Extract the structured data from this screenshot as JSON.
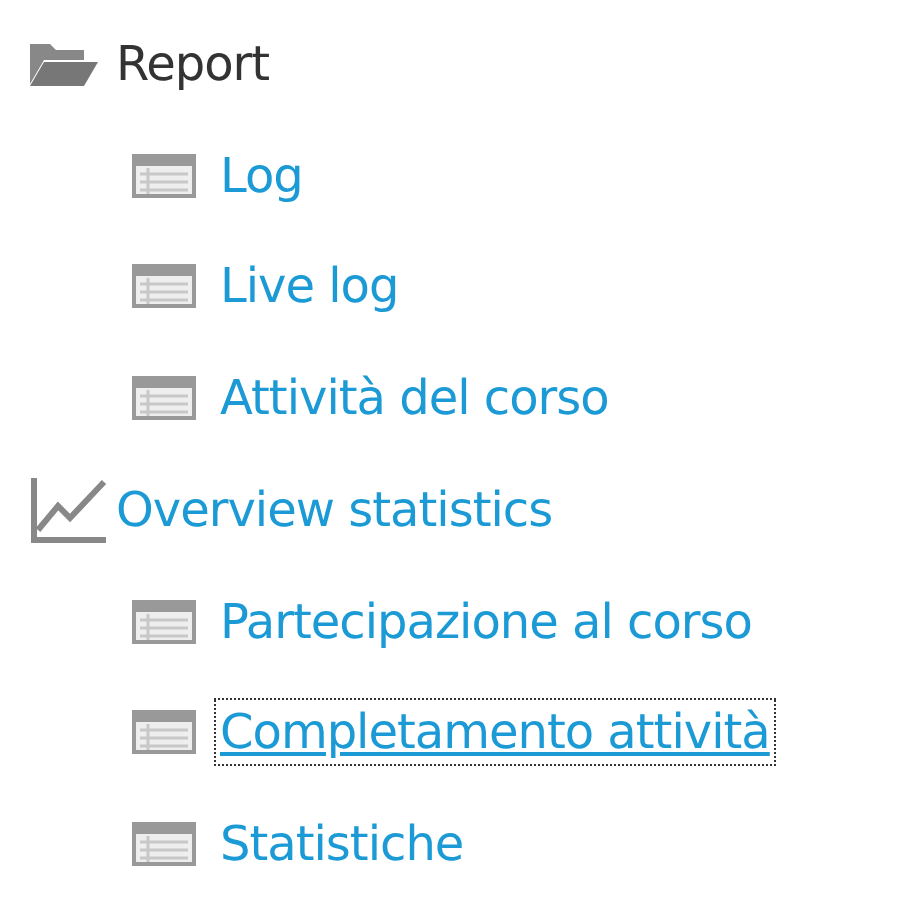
{
  "tree": [
    {
      "label": "Report",
      "kind": "folder",
      "focused": false,
      "children": [
        {
          "label": "Log",
          "kind": "report",
          "focused": false
        },
        {
          "label": "Live log",
          "kind": "report",
          "focused": false
        },
        {
          "label": "Attività del corso",
          "kind": "report",
          "focused": false
        }
      ]
    },
    {
      "label": "Overview statistics",
      "kind": "chart",
      "focused": false,
      "children": [
        {
          "label": "Partecipazione al corso",
          "kind": "report",
          "focused": false
        },
        {
          "label": "Completamento attività",
          "kind": "report",
          "focused": true
        },
        {
          "label": "Statistiche",
          "kind": "report",
          "focused": false
        }
      ]
    }
  ]
}
